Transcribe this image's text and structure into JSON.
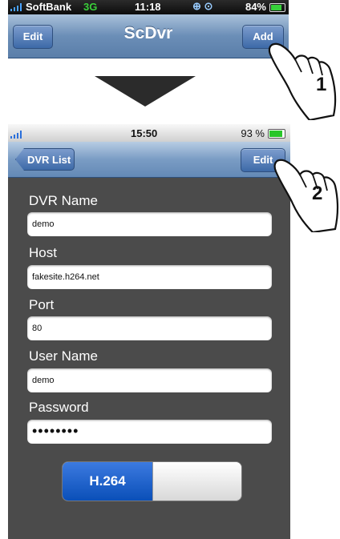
{
  "screen1": {
    "status": {
      "carrier": "SoftBank",
      "network": "3G",
      "time": "11:18",
      "battery": "84%"
    },
    "nav": {
      "left_button": "Edit",
      "title": "ScDvr",
      "right_button": "Add"
    }
  },
  "screen2": {
    "status": {
      "time": "15:50",
      "battery": "93 %"
    },
    "nav": {
      "back_button": "DVR List",
      "right_button": "Edit"
    },
    "form": {
      "dvr_name_label": "DVR Name",
      "dvr_name_value": "demo",
      "host_label": "Host",
      "host_value": "fakesite.h264.net",
      "port_label": "Port",
      "port_value": "80",
      "user_label": "User Name",
      "user_value": "demo",
      "password_label": "Password",
      "password_value": "••••••••"
    },
    "toggle": {
      "on_label": "H.264"
    }
  },
  "callouts": {
    "step1": "1",
    "step2": "2"
  }
}
